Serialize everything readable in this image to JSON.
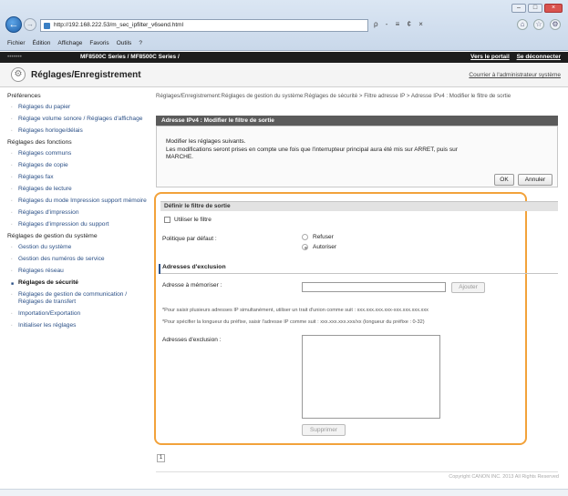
{
  "browser": {
    "url": "http://192.168.222.53/m_sec_ipfilter_v6send.html",
    "address_tools": "ρ - ≡ ¢ ×",
    "window_controls": [
      "–",
      "□",
      "×"
    ],
    "menu": [
      "Fichier",
      "Édition",
      "Affichage",
      "Favoris",
      "Outils",
      "?"
    ]
  },
  "device_bar": {
    "model_left": "•••••••",
    "model": "MF8500C Series / MF8500C Series /",
    "portal_link": "Vers le portail",
    "logout_link": "Se déconnecter"
  },
  "header": {
    "title": "Réglages/Enregistrement",
    "admin_link": "Courrier à l'administrateur système"
  },
  "sidebar": {
    "sections": [
      {
        "title": "Préférences",
        "items": [
          {
            "label": "Réglages du papier"
          },
          {
            "label": "Réglage volume sonore / Réglages d'affichage"
          },
          {
            "label": "Réglages horloge/délais"
          }
        ]
      },
      {
        "title": "Réglages des fonctions",
        "items": [
          {
            "label": "Réglages communs"
          },
          {
            "label": "Réglages de copie"
          },
          {
            "label": "Réglages fax"
          },
          {
            "label": "Réglages de lecture"
          },
          {
            "label": "Réglages du mode Impression support mémoire"
          },
          {
            "label": "Réglages d'impression"
          },
          {
            "label": "Réglages d'impression du support"
          }
        ]
      },
      {
        "title": "Réglages de gestion du système",
        "items": [
          {
            "label": "Gestion du système"
          },
          {
            "label": "Gestion des numéros de service"
          },
          {
            "label": "Réglages réseau"
          },
          {
            "label": "Réglages de sécurité",
            "active": true
          },
          {
            "label": "Réglages de gestion de communication / Réglages de transfert"
          },
          {
            "label": "Importation/Exportation"
          },
          {
            "label": "Initialiser les réglages"
          }
        ]
      }
    ]
  },
  "main": {
    "breadcrumb": "Réglages/Enregistrement:Réglages de gestion du système:Réglages de sécurité > Filtre adresse IP > Adresse IPv4 : Modifier le filtre de sortie",
    "panel_title": "Adresse IPv4 : Modifier le filtre de sortie",
    "instructions": [
      "Modifier les réglages suivants.",
      "Les modifications seront prises en compte une fois que l'interrupteur principal aura été mis sur ARRET, puis sur",
      "MARCHE."
    ],
    "ok_label": "OK",
    "cancel_label": "Annuler",
    "filter_section": "Définir le filtre de sortie",
    "use_filter_label": "Utiliser le filtre",
    "use_filter_checked": false,
    "default_policy_label": "Politique par défaut :",
    "policy_options": [
      {
        "label": "Refuser",
        "selected": false
      },
      {
        "label": "Autoriser",
        "selected": true
      }
    ],
    "exclusion_section": "Adresses d'exclusion",
    "memorize_label": "Adresse à mémoriser :",
    "memorize_value": "",
    "add_label": "Ajouter",
    "note1": "*Pour saisir plusieurs adresses IP simultanément, utiliser un trait d'union comme suit : xxx.xxx.xxx.xxx-xxx.xxx.xxx.xxx",
    "note2": "*Pour spécifier la longueur du préfixe, saisir l'adresse IP comme suit : xxx.xxx.xxx.xxx/xx (longueur du préfixe : 0-32)",
    "exclusion_label": "Adresses d'exclusion :",
    "delete_label": "Supprimer",
    "page_number": "1"
  },
  "footer": {
    "copyright": "Copyright CANON INC. 2013 All Rights Reserved"
  }
}
